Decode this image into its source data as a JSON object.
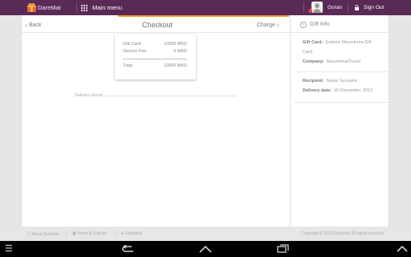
{
  "topbar": {
    "brand": "DareMat",
    "menu_label": "Main menu",
    "user_name": "Goran",
    "signout_label": "Sign Out"
  },
  "checkout": {
    "title": "Checkout",
    "back_label": "Back",
    "forward_label": "Charge"
  },
  "summary": {
    "rows": [
      {
        "label": "Gift Card:",
        "value": "10000 MKD"
      },
      {
        "label": "Service Fee:",
        "value": "0 MKD"
      }
    ],
    "total_label": "Total:",
    "total_value": "10000 MKD"
  },
  "delivery": {
    "email_label": "Delivery Email"
  },
  "gift_info": {
    "title": "Gift Info",
    "card_label": "Gift Card:",
    "card_value_1": "Explore Macedonia Gift",
    "card_value_2": "Card",
    "company_label": "Company:",
    "company_value": "MacedoniaTravel",
    "recipient_label": "Recipient:",
    "recipient_value": "Name Surname",
    "date_label": "Delivery date:",
    "date_value": "20 December, 2013"
  },
  "footer": {
    "about": "About DareMat",
    "terms": "Terms & Policies",
    "feedback": "Feedback",
    "copyright": "Copyright © 2013 DareMat. All rights reserved."
  },
  "colors": {
    "topbar": "#5a2a57",
    "accent": "#f39c2b"
  }
}
